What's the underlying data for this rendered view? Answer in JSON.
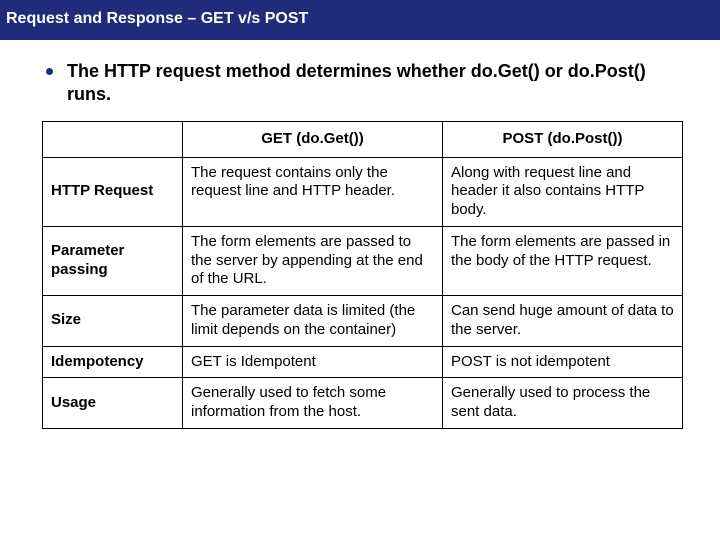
{
  "title": "Request and Response – GET v/s POST",
  "bullet": "The HTTP request method determines whether do.Get() or do.Post() runs.",
  "table": {
    "head": {
      "blank": "",
      "get": "GET (do.Get())",
      "post": "POST (do.Post())"
    },
    "rows": [
      {
        "label": "HTTP Request",
        "get": "The request contains only the request line and  HTTP header.",
        "post": "Along with request line and header it also contains HTTP body."
      },
      {
        "label": "Parameter passing",
        "get": "The form elements are passed to the server by appending at the end of the URL.",
        "post": "The form elements are passed in the body of the HTTP request."
      },
      {
        "label": "Size",
        "get": "The parameter data is limited (the limit depends on the container)",
        "post": "Can send huge amount of data to the server."
      },
      {
        "label": "Idempotency",
        "get": "GET is Idempotent",
        "post": "POST is not idempotent"
      },
      {
        "label": "Usage",
        "get": "Generally used to fetch some information from the host.",
        "post": "Generally used to process the sent data."
      }
    ]
  }
}
